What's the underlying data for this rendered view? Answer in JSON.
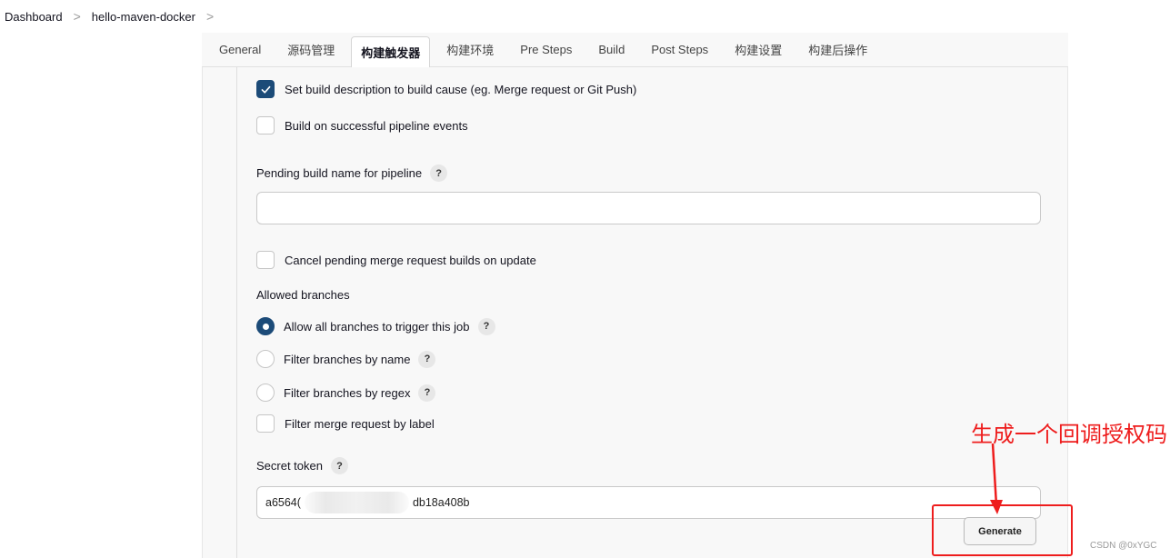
{
  "breadcrumb": {
    "item1": "Dashboard",
    "item2": "hello-maven-docker",
    "sep": ">"
  },
  "tabs": [
    {
      "label": "General"
    },
    {
      "label": "源码管理"
    },
    {
      "label": "构建触发器"
    },
    {
      "label": "构建环境"
    },
    {
      "label": "Pre Steps"
    },
    {
      "label": "Build"
    },
    {
      "label": "Post Steps"
    },
    {
      "label": "构建设置"
    },
    {
      "label": "构建后操作"
    }
  ],
  "form": {
    "set_build_description": "Set build description to build cause (eg. Merge request or Git Push)",
    "build_on_pipeline": "Build on successful pipeline events",
    "pending_build_name_label": "Pending build name for pipeline",
    "pending_build_name_value": "",
    "cancel_pending": "Cancel pending merge request builds on update",
    "allowed_branches_label": "Allowed branches",
    "radio_all": "Allow all branches to trigger this job",
    "radio_name": "Filter branches by name",
    "radio_regex": "Filter branches by regex",
    "filter_label": "Filter merge request by label",
    "secret_token_label": "Secret token",
    "secret_token_prefix": "a6564(",
    "secret_token_suffix": "db18a408b",
    "generate_button": "Generate",
    "help": "?"
  },
  "annotation": {
    "text": "生成一个回调授权码",
    "color": "#ee1d1d"
  },
  "watermark": "CSDN @0xYGC",
  "colors": {
    "accent": "#1c4b78",
    "annotation_red": "#ee1d1d"
  }
}
